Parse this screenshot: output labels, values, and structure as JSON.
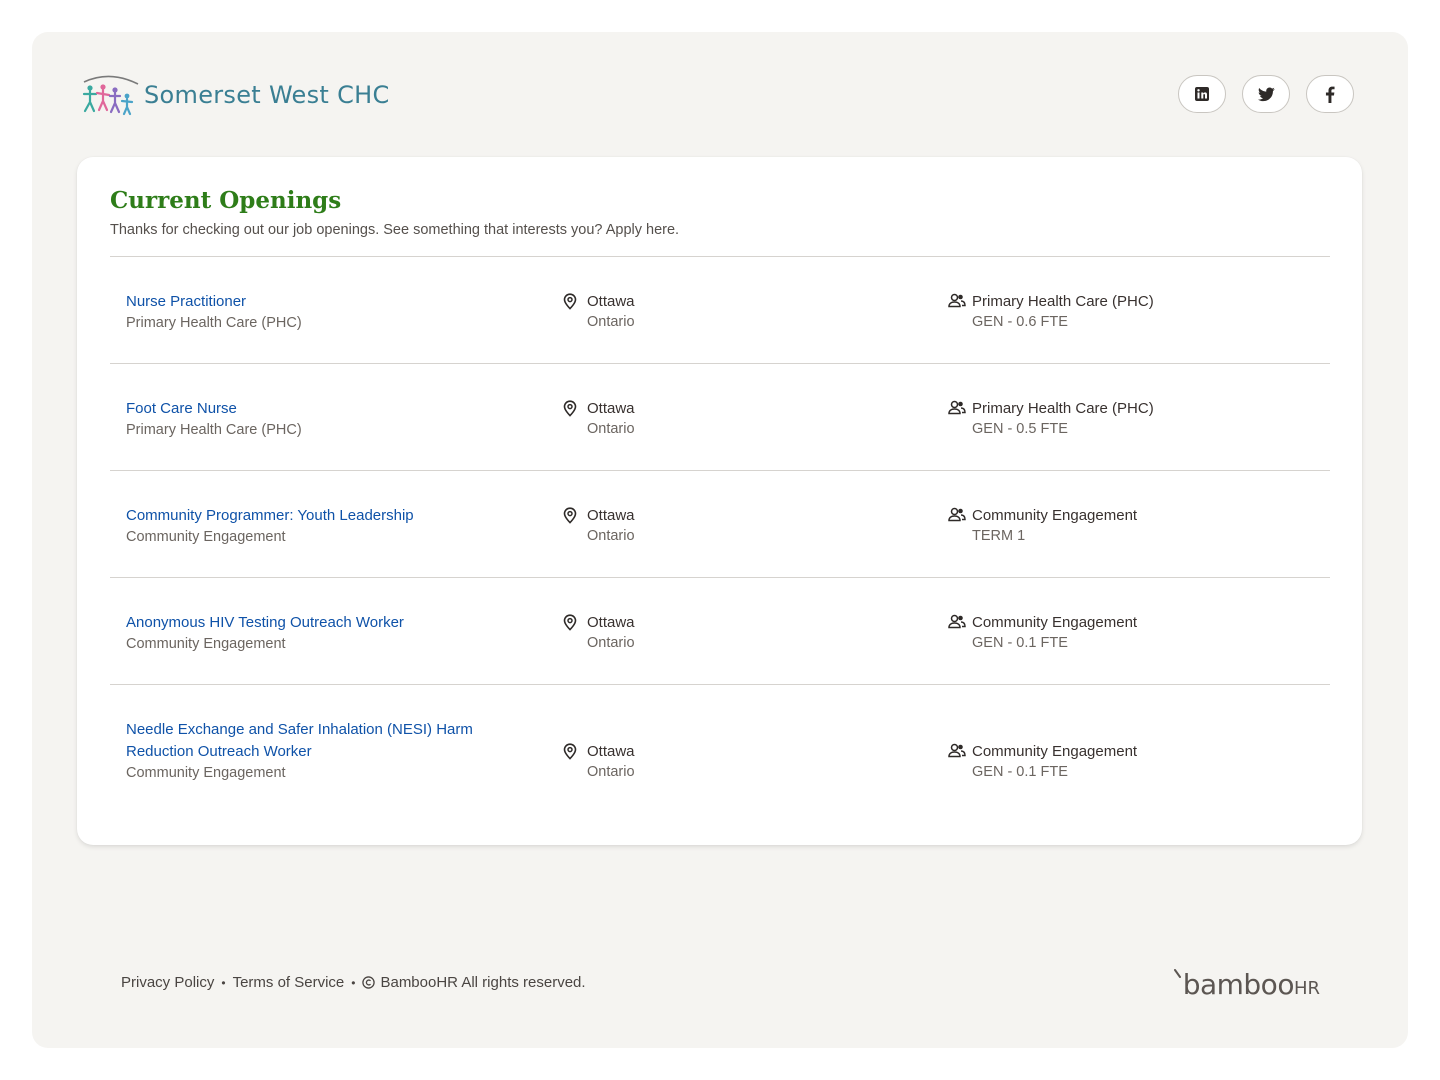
{
  "brand": {
    "name": "Somerset West CHC",
    "accent": "#3a7f93"
  },
  "socials": [
    {
      "name": "linkedin-icon"
    },
    {
      "name": "twitter-icon"
    },
    {
      "name": "facebook-icon"
    }
  ],
  "openings": {
    "title": "Current Openings",
    "subtitle": "Thanks for checking out our job openings. See something that interests you? Apply here.",
    "title_color": "#2e7d19",
    "link_color": "#0f52a8",
    "jobs": [
      {
        "title": "Nurse Practitioner",
        "department": "Primary Health Care (PHC)",
        "city": "Ottawa",
        "province": "Ontario",
        "team": "Primary Health Care (PHC)",
        "type": "GEN - 0.6 FTE"
      },
      {
        "title": "Foot Care Nurse",
        "department": "Primary Health Care (PHC)",
        "city": "Ottawa",
        "province": "Ontario",
        "team": "Primary Health Care (PHC)",
        "type": "GEN - 0.5 FTE"
      },
      {
        "title": "Community Programmer: Youth Leadership",
        "department": "Community Engagement",
        "city": "Ottawa",
        "province": "Ontario",
        "team": "Community Engagement",
        "type": "TERM 1"
      },
      {
        "title": "Anonymous HIV Testing Outreach Worker",
        "department": "Community Engagement",
        "city": "Ottawa",
        "province": "Ontario",
        "team": "Community Engagement",
        "type": "GEN - 0.1 FTE"
      },
      {
        "title": "Needle Exchange and Safer Inhalation (NESI) Harm Reduction Outreach Worker",
        "department": "Community Engagement",
        "city": "Ottawa",
        "province": "Ontario",
        "team": "Community Engagement",
        "type": "GEN - 0.1 FTE"
      }
    ]
  },
  "footer": {
    "privacy": "Privacy Policy",
    "terms": "Terms of Service",
    "copyright": "BambooHR All rights reserved.",
    "bamboo_logo": "bamboo",
    "bamboo_logo_hr": "HR"
  }
}
